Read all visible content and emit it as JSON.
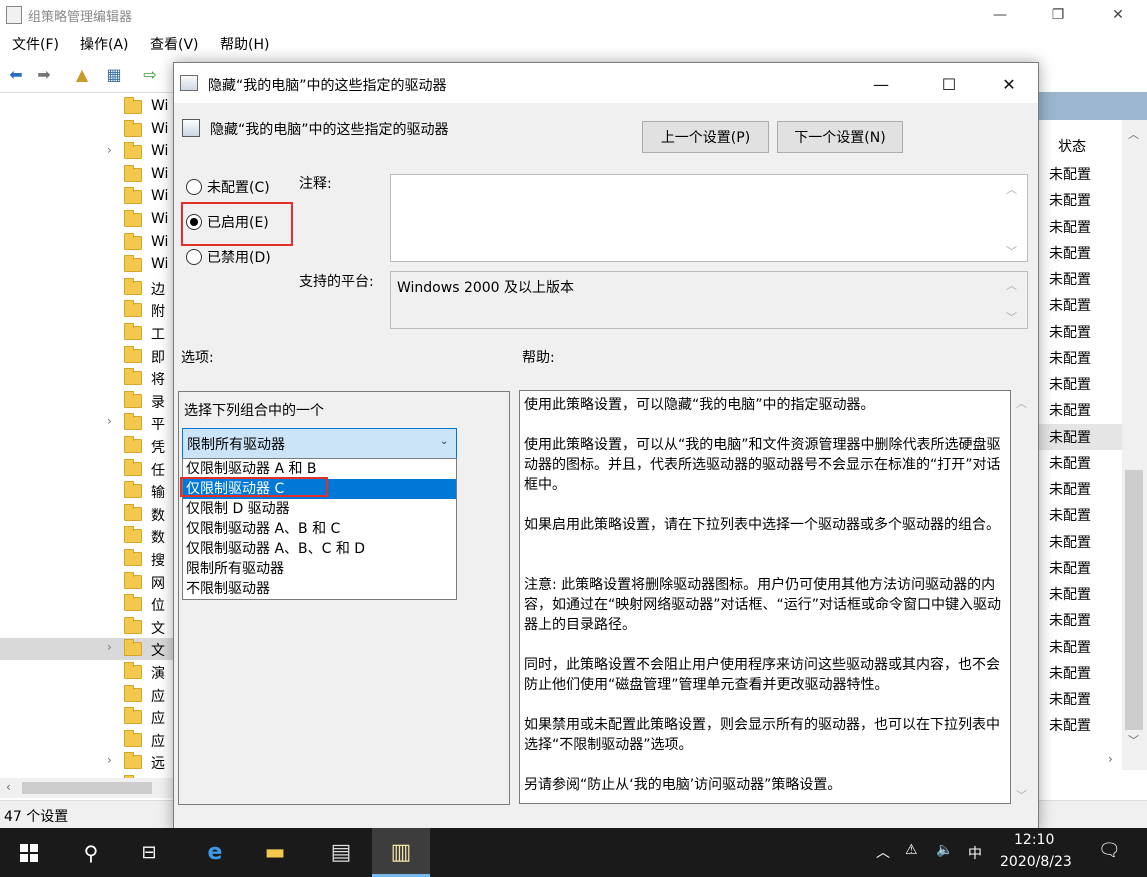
{
  "app": {
    "title": "组策略管理编辑器",
    "menu": [
      "文件(F)",
      "操作(A)",
      "查看(V)",
      "帮助(H)"
    ],
    "tree_items": [
      "Wi",
      "Wi",
      "Wi",
      "Wi",
      "Wi",
      "Wi",
      "Wi",
      "Wi",
      "边",
      "附",
      "工",
      "即",
      "将",
      "录",
      "平",
      "凭",
      "任",
      "输",
      "数",
      "数",
      "搜",
      "网",
      "位",
      "文",
      "文",
      "演",
      "应",
      "应",
      "应",
      "远",
      ""
    ],
    "status_header": "状态",
    "status_values": [
      "未配置",
      "未配置",
      "未配置",
      "未配置",
      "未配置",
      "未配置",
      "未配置",
      "未配置",
      "未配置",
      "未配置",
      "未配置",
      "未配置",
      "未配置",
      "未配置",
      "未配置",
      "未配置",
      "未配置",
      "未配置",
      "未配置",
      "未配置",
      "未配置",
      "未配置"
    ],
    "statusbar": "47 个设置"
  },
  "dialog": {
    "title": "隐藏“我的电脑”中的这些指定的驱动器",
    "header": "隐藏“我的电脑”中的这些指定的驱动器",
    "prev_button": "上一个设置(P)",
    "next_button": "下一个设置(N)",
    "radio_not_configured": "未配置(C)",
    "radio_enabled": "已启用(E)",
    "radio_disabled": "已禁用(D)",
    "selected_state": "enabled",
    "comment_label": "注释:",
    "comment_value": "",
    "platform_label": "支持的平台:",
    "platform_value": "Windows 2000 及以上版本",
    "options_label": "选项:",
    "help_label": "帮助:",
    "options_prompt": "选择下列组合中的一个",
    "dropdown_value": "限制所有驱动器",
    "dropdown_options": [
      "仅限制驱动器 A 和 B",
      "仅限制驱动器 C",
      "仅限制 D 驱动器",
      "仅限制驱动器 A、B 和 C",
      "仅限制驱动器 A、B、C 和 D",
      "限制所有驱动器",
      "不限制驱动器"
    ],
    "dropdown_highlighted": "仅限制驱动器 C",
    "help_paragraphs": [
      "使用此策略设置，可以隐藏“我的电脑”中的指定驱动器。",
      "使用此策略设置，可以从“我的电脑”和文件资源管理器中删除代表所选硬盘驱动器的图标。并且，代表所选驱动器的驱动器号不会显示在标准的“打开”对话框中。",
      "如果启用此策略设置，请在下拉列表中选择一个驱动器或多个驱动器的组合。",
      "注意: 此策略设置将删除驱动器图标。用户仍可使用其他方法访问驱动器的内容，如通过在“映射网络驱动器”对话框、“运行”对话框或命令窗口中键入驱动器上的目录路径。",
      "同时，此策略设置不会阻止用户使用程序来访问这些驱动器或其内容，也不会防止他们使用“磁盘管理”管理单元查看并更改驱动器特性。",
      "如果禁用或未配置此策略设置，则会显示所有的驱动器，也可以在下拉列表中选择“不限制驱动器”选项。",
      "另请参阅“防止从‘我的电脑’访问驱动器”策略设置。"
    ]
  },
  "taskbar": {
    "time": "12:10",
    "date": "2020/8/23",
    "ime": "中"
  },
  "colors": {
    "highlight_red": "#e0302a",
    "selection_blue": "#0078d7",
    "dropdown_fill": "#cce4f7",
    "taskbar": "#1a1a1a"
  }
}
